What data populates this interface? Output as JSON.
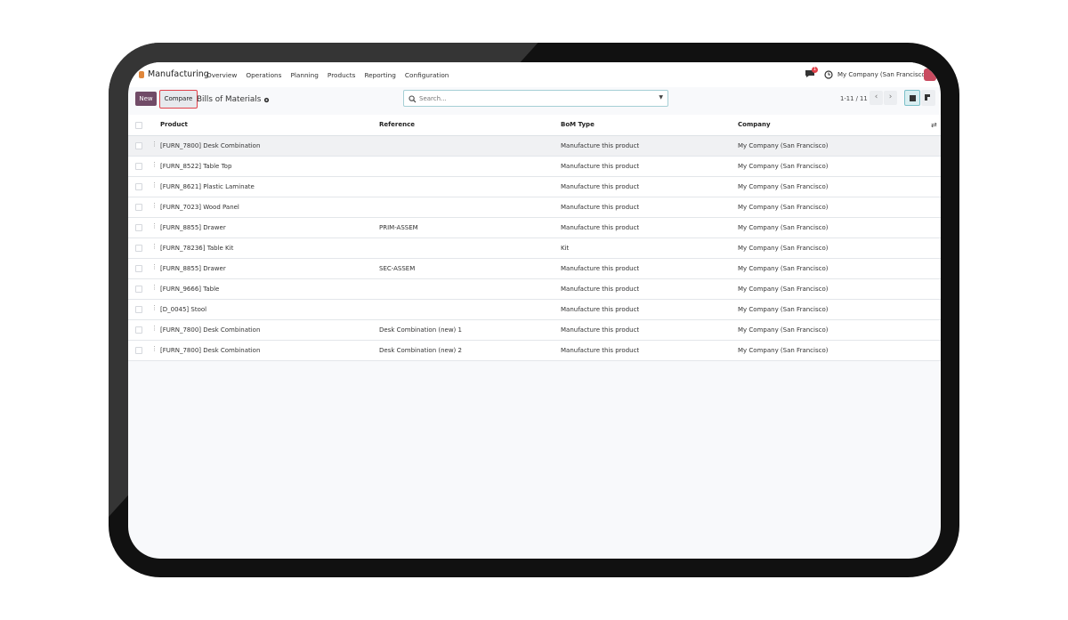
{
  "app": {
    "name": "Manufacturing"
  },
  "menu": [
    "Overview",
    "Operations",
    "Planning",
    "Products",
    "Reporting",
    "Configuration"
  ],
  "systray": {
    "messages_badge": "1",
    "company": "My Company (San Francisco)"
  },
  "control": {
    "new_label": "New",
    "compare_label": "Compare",
    "breadcrumb": "Bills of Materials",
    "search_placeholder": "Search...",
    "pager": "1-11 / 11"
  },
  "columns": {
    "product": "Product",
    "reference": "Reference",
    "bom_type": "BoM Type",
    "company": "Company"
  },
  "rows": [
    {
      "product": "[FURN_7800] Desk Combination",
      "reference": "",
      "bom_type": "Manufacture this product",
      "company": "My Company (San Francisco)"
    },
    {
      "product": "[FURN_8522] Table Top",
      "reference": "",
      "bom_type": "Manufacture this product",
      "company": "My Company (San Francisco)"
    },
    {
      "product": "[FURN_8621] Plastic Laminate",
      "reference": "",
      "bom_type": "Manufacture this product",
      "company": "My Company (San Francisco)"
    },
    {
      "product": "[FURN_7023] Wood Panel",
      "reference": "",
      "bom_type": "Manufacture this product",
      "company": "My Company (San Francisco)"
    },
    {
      "product": "[FURN_8855] Drawer",
      "reference": "PRIM-ASSEM",
      "bom_type": "Manufacture this product",
      "company": "My Company (San Francisco)"
    },
    {
      "product": "[FURN_78236] Table Kit",
      "reference": "",
      "bom_type": "Kit",
      "company": "My Company (San Francisco)"
    },
    {
      "product": "[FURN_8855] Drawer",
      "reference": "SEC-ASSEM",
      "bom_type": "Manufacture this product",
      "company": "My Company (San Francisco)"
    },
    {
      "product": "[FURN_9666] Table",
      "reference": "",
      "bom_type": "Manufacture this product",
      "company": "My Company (San Francisco)"
    },
    {
      "product": "[D_0045] Stool",
      "reference": "",
      "bom_type": "Manufacture this product",
      "company": "My Company (San Francisco)"
    },
    {
      "product": "[FURN_7800] Desk Combination",
      "reference": "Desk Combination (new) 1",
      "bom_type": "Manufacture this product",
      "company": "My Company (San Francisco)"
    },
    {
      "product": "[FURN_7800] Desk Combination",
      "reference": "Desk Combination (new) 2",
      "bom_type": "Manufacture this product",
      "company": "My Company (San Francisco)"
    }
  ],
  "colors": {
    "primary": "#714b67",
    "highlight": "#e0414a",
    "accent": "#7cc0c9"
  }
}
